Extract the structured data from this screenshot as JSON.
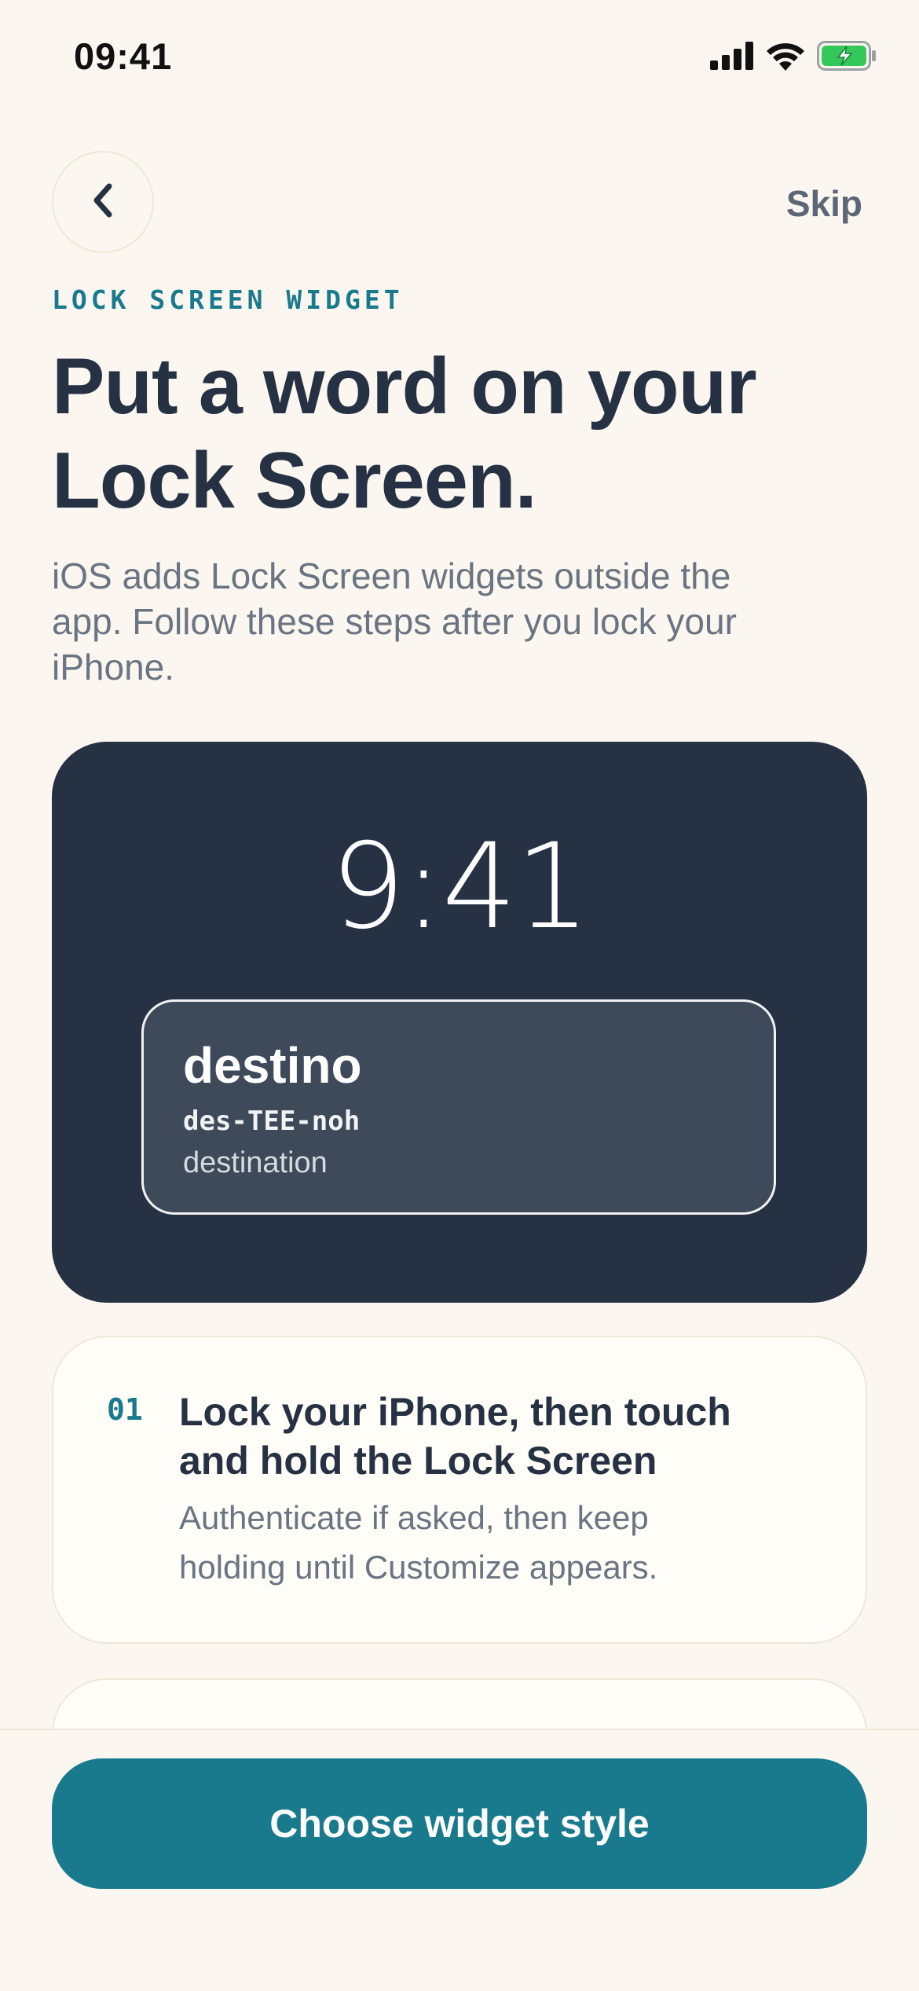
{
  "status_bar": {
    "time": "09:41",
    "icons": [
      "cellular-signal-icon",
      "wifi-icon",
      "battery-charging-icon"
    ],
    "battery_color": "#34C759"
  },
  "nav": {
    "back_icon": "chevron-left-icon",
    "skip_label": "Skip"
  },
  "header": {
    "eyebrow": "LOCK SCREEN WIDGET",
    "title_line1": "Put a word on your",
    "title_line2": "Lock Screen.",
    "subtitle_line1": "iOS adds Lock Screen widgets outside the",
    "subtitle_line2": "app. Follow these steps after you lock your",
    "subtitle_line3": "iPhone."
  },
  "preview": {
    "time": "9:41",
    "widget": {
      "word": "destino",
      "pronunciation": "des-TEE-noh",
      "definition": "destination"
    }
  },
  "steps": [
    {
      "number": "01",
      "title_line1": "Lock your iPhone, then touch",
      "title_line2": "and hold the Lock Screen",
      "desc_line1": "Authenticate if asked, then keep",
      "desc_line2": "holding until Customize appears."
    }
  ],
  "cta": {
    "label": "Choose widget style"
  },
  "colors": {
    "background": "#FBF7F0",
    "accent": "#197A8E",
    "dark": "#263144",
    "text": "#263244",
    "muted": "#6A7482"
  }
}
